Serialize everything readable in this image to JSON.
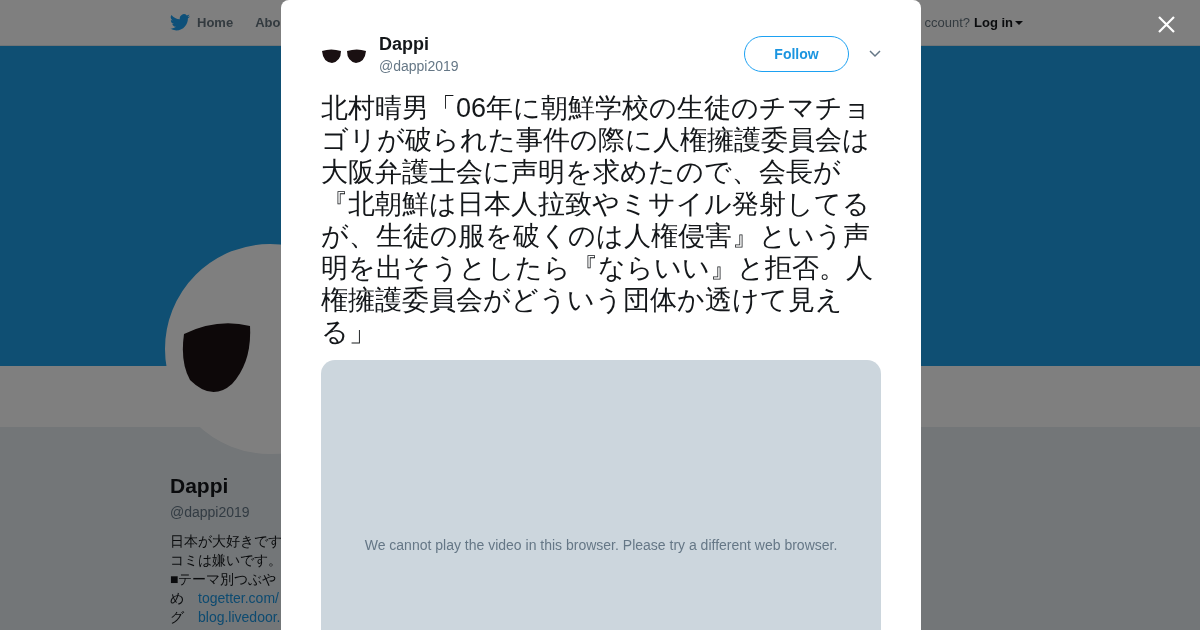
{
  "background_page": {
    "nav": {
      "items": [
        "Home",
        "Abo"
      ],
      "account_prompt": "ccount?",
      "login": "Log in"
    },
    "profile": {
      "name": "Dappi",
      "handle": "@dappi2019",
      "bio_lines": [
        "日本が大好きです",
        "コミは嫌いです。",
        "■テーマ別つぶや"
      ],
      "links": [
        {
          "label": "め",
          "url": "togetter.com/"
        },
        {
          "label": "グ",
          "url": "blog.livedoor."
        }
      ]
    }
  },
  "modal": {
    "author": {
      "name": "Dappi",
      "handle": "@dappi2019"
    },
    "follow_button": "Follow",
    "tweet_text": "北村晴男「06年に朝鮮学校の生徒のチマチョゴリが破られた事件の際に人権擁護委員会は大阪弁護士会に声明を求めたので、会長が『北朝鮮は日本人拉致やミサイル発射してるが、生徒の服を破くのは人権侵害』という声明を出そうとしたら『ならいい』と拒否。人権擁護委員会がどういう団体か透けて見える」",
    "video_message": "We cannot play the video in this browser. Please try a different web browser."
  }
}
